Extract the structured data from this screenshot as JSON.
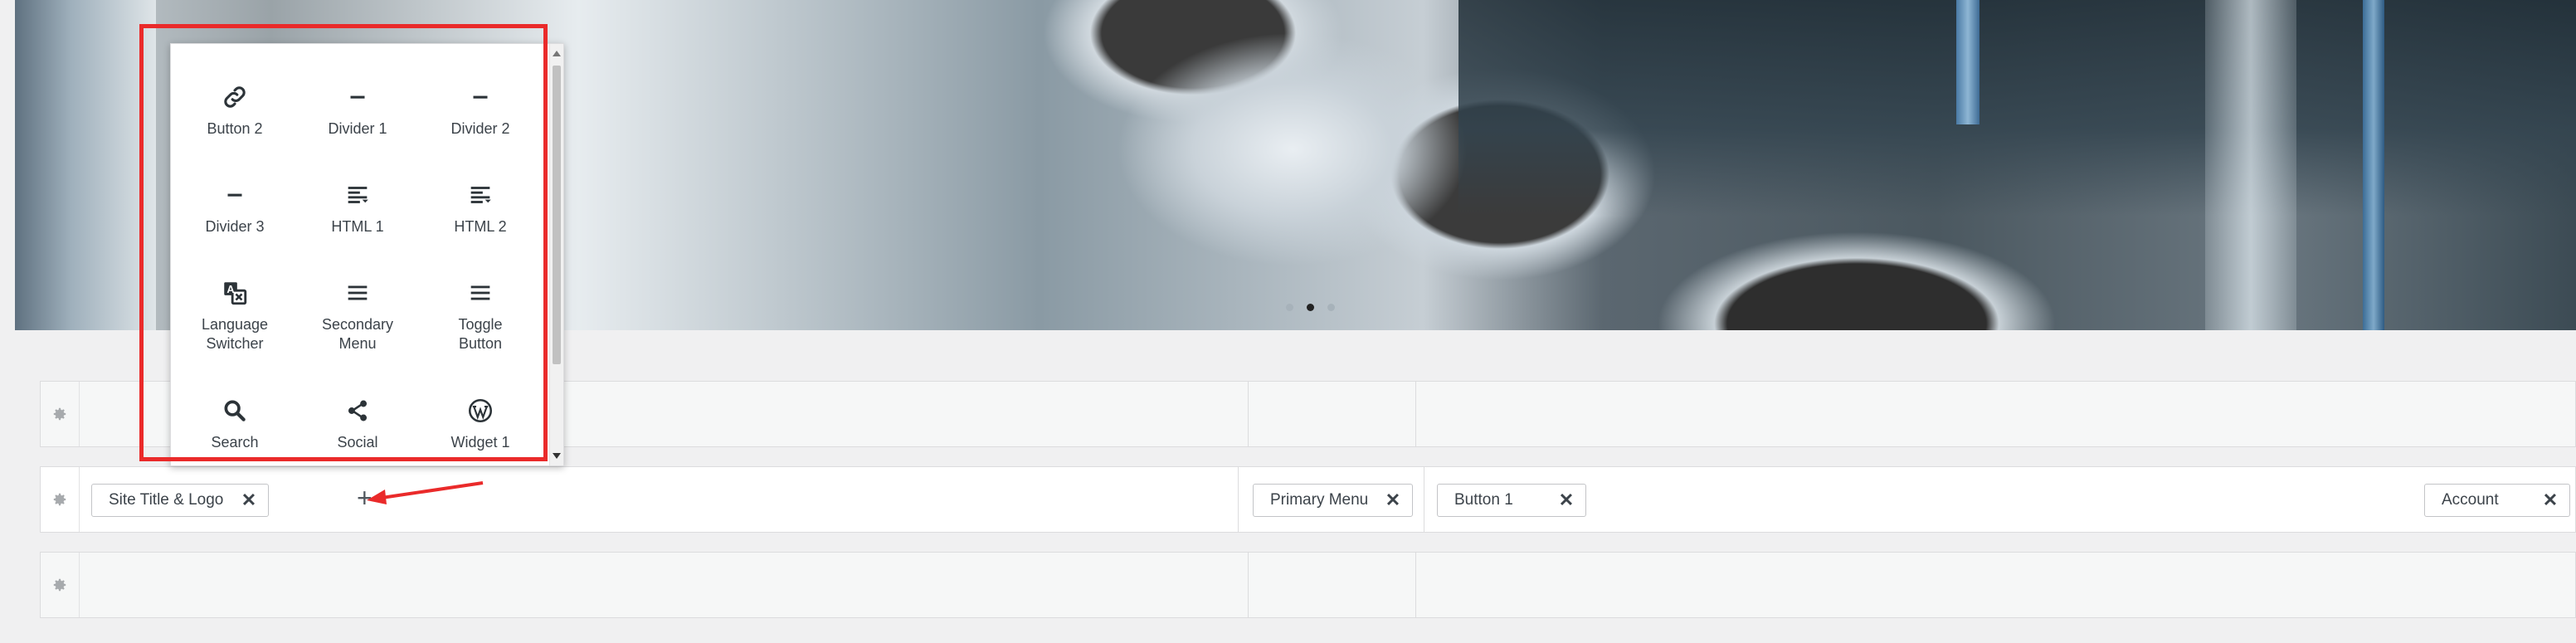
{
  "hero": {
    "slider_dots": 3,
    "active_dot": 2
  },
  "rows": {
    "top": {},
    "main": {
      "left_chips": [
        {
          "label": "Site Title & Logo"
        }
      ],
      "add_label": "+",
      "center_chips": [
        {
          "label": "Primary Menu"
        }
      ],
      "right_chips": [
        {
          "label": "Button 1"
        }
      ],
      "far_right_chips": [
        {
          "label": "Account"
        }
      ],
      "remove_glyph": "✕"
    },
    "bottom": {}
  },
  "popup": {
    "items": [
      {
        "label": "Button 2",
        "icon": "link-icon"
      },
      {
        "label": "Divider 1",
        "icon": "divider-icon"
      },
      {
        "label": "Divider 2",
        "icon": "divider-icon"
      },
      {
        "label": "Divider 3",
        "icon": "divider-icon"
      },
      {
        "label": "HTML 1",
        "icon": "html-icon"
      },
      {
        "label": "HTML 2",
        "icon": "html-icon"
      },
      {
        "label": "Language Switcher",
        "icon": "translate-icon"
      },
      {
        "label": "Secondary Menu",
        "icon": "menu-icon"
      },
      {
        "label": "Toggle Button",
        "icon": "menu-icon"
      },
      {
        "label": "Search",
        "icon": "search-icon"
      },
      {
        "label": "Social",
        "icon": "share-icon"
      },
      {
        "label": "Widget 1",
        "icon": "wordpress-icon"
      }
    ]
  },
  "colors": {
    "annotation": "#ea2a2a",
    "icon": "#2c3338"
  }
}
